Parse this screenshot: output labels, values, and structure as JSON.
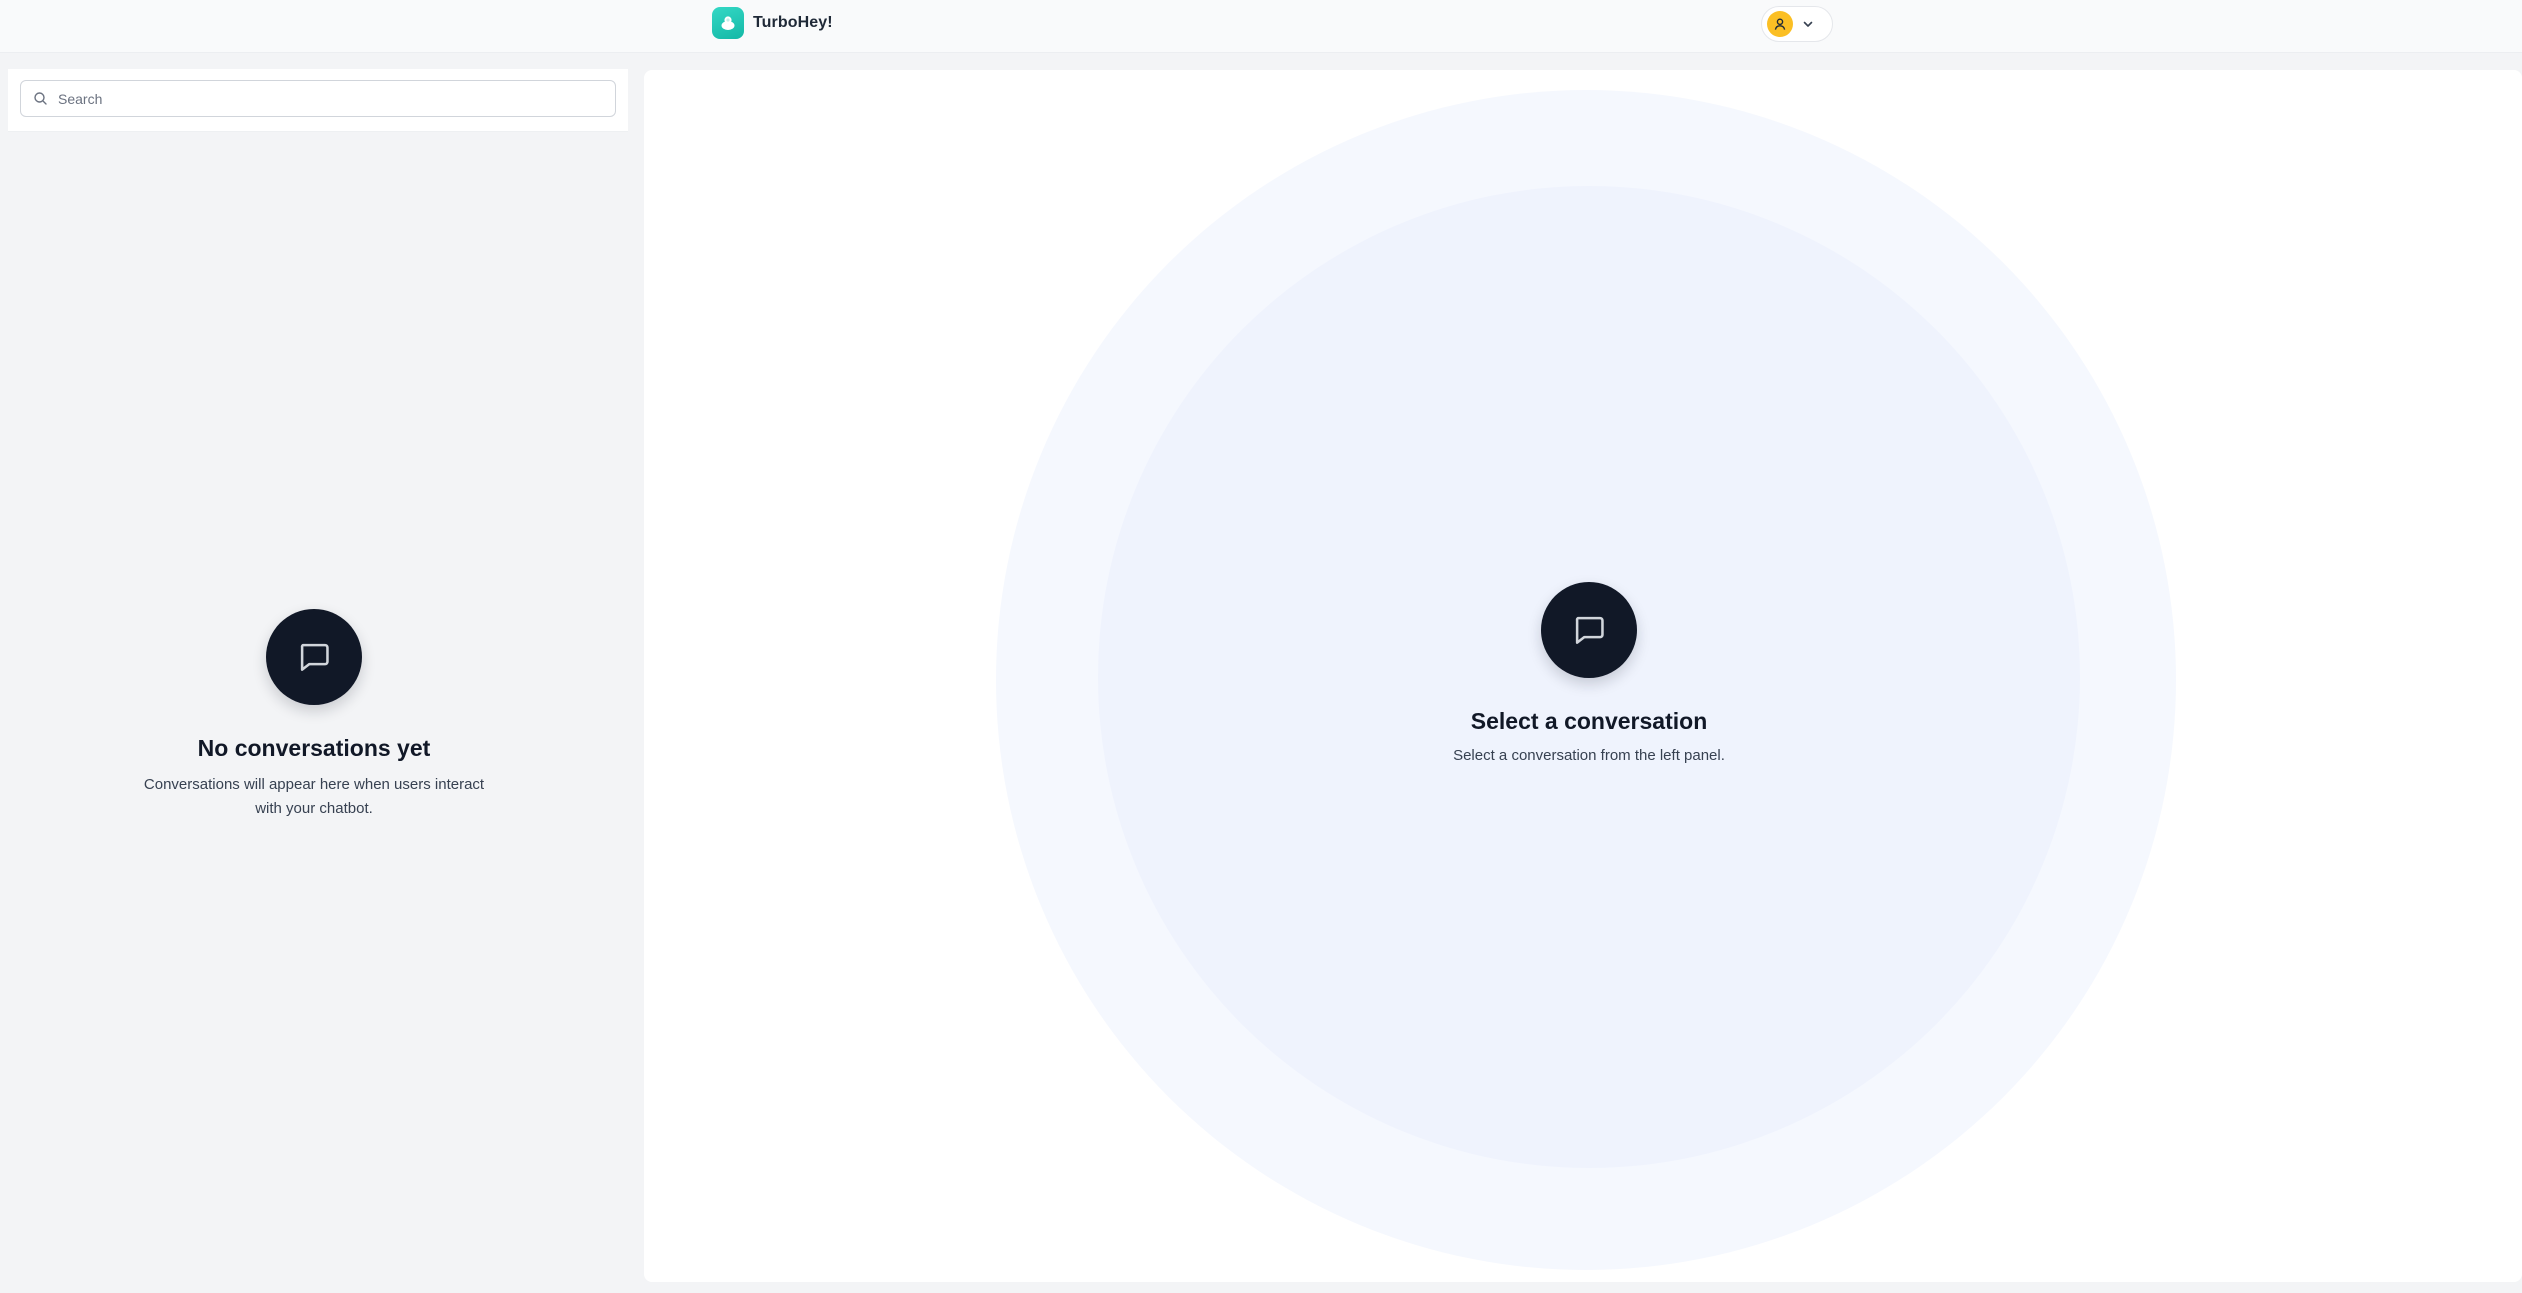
{
  "header": {
    "app_name": "TurboHey!",
    "brand_color": "#14b8a6",
    "avatar_color": "#fbbf24",
    "logo_icon": "chatbot-logo-icon",
    "user_icon": "user-icon",
    "menu_icon": "chevron-down-icon"
  },
  "sidebar": {
    "search": {
      "placeholder": "Search",
      "value": ""
    },
    "empty_state": {
      "icon": "chat-bubble-icon",
      "title": "No conversations yet",
      "description": "Conversations will appear here when users interact with your chatbot."
    }
  },
  "main": {
    "empty_state": {
      "icon": "chat-bubble-icon",
      "title": "Select a conversation",
      "description": "Select a conversation from the left panel."
    }
  }
}
